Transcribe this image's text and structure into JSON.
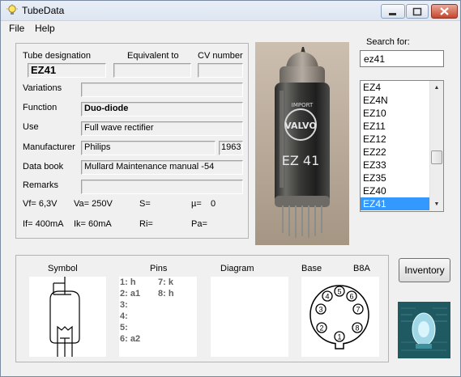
{
  "window": {
    "title": "TubeData"
  },
  "menu": {
    "file": "File",
    "help": "Help"
  },
  "details": {
    "tube_designation_label": "Tube designation",
    "tube_designation": "EZ41",
    "equivalent_label": "Equivalent to",
    "equivalent": "",
    "cv_label": "CV number",
    "cv": "",
    "variations_label": "Variations",
    "variations": "",
    "function_label": "Function",
    "function": "Duo-diode",
    "use_label": "Use",
    "use": "Full wave rectifier",
    "manufacturer_label": "Manufacturer",
    "manufacturer": "Philips",
    "year": "1963",
    "databook_label": "Data book",
    "databook": "Mullard Maintenance manual -54",
    "remarks_label": "Remarks",
    "remarks": ""
  },
  "params": {
    "vf": "Vf= 6,3V",
    "va": "Va= 250V",
    "s": "S=",
    "mu": "µ=",
    "mu_value": "0",
    "if": "If= 400mA",
    "ik": "Ik= 60mA",
    "ri": "Ri=",
    "pa": "Pa="
  },
  "search": {
    "label": "Search for:",
    "value": "ez41",
    "items": [
      "EZ4",
      "EZ4N",
      "EZ10",
      "EZ11",
      "EZ12",
      "EZ22",
      "EZ33",
      "EZ35",
      "EZ40",
      "EZ41"
    ],
    "selected_index": 9,
    "scroll_up": "▲",
    "scroll_down": "▼"
  },
  "bottom": {
    "symbol_label": "Symbol",
    "pins_label": "Pins",
    "diagram_label": "Diagram",
    "base_label": "Base",
    "base_type": "B8A",
    "pins_col1": [
      "1: h",
      "2: a1",
      "3:",
      "4:",
      "5:",
      "6: a2"
    ],
    "pins_col2": [
      "7: k",
      "8: h"
    ],
    "base_pins": [
      "1",
      "2",
      "3",
      "4",
      "5",
      "6",
      "7",
      "8"
    ]
  },
  "buttons": {
    "inventory": "Inventory"
  },
  "photo": {
    "tube_print_1": "VALVO",
    "tube_print_2": "EZ 41",
    "tube_print_3": "IMPORT"
  },
  "colors": {
    "selection": "#3399ff",
    "close_button": "#c6452c"
  }
}
